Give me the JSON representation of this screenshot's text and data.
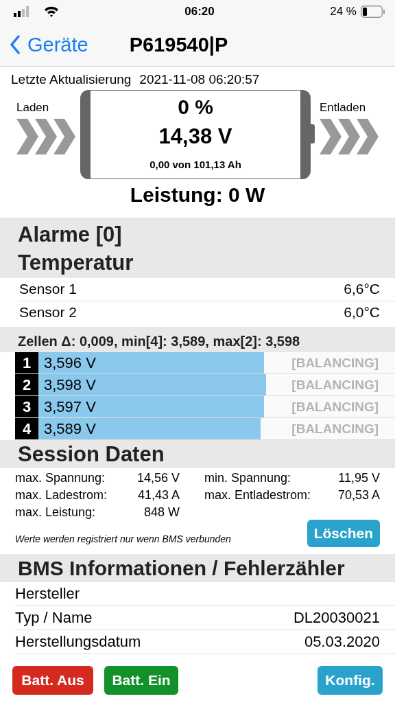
{
  "status_bar": {
    "time": "06:20",
    "battery_text": "24 %"
  },
  "nav": {
    "back_label": "Geräte",
    "title": "P619540|P"
  },
  "update": {
    "label": "Letzte Aktualisierung",
    "value": "2021-11-08 06:20:57"
  },
  "battery": {
    "charge_label": "Laden",
    "discharge_label": "Entladen",
    "percent": "0 %",
    "voltage": "14,38 V",
    "capacity": "0,00 von 101,13 Ah",
    "power": "Leistung: 0 W"
  },
  "alarms": {
    "title": "Alarme [0]"
  },
  "temperature": {
    "title": "Temperatur",
    "sensors": [
      {
        "name": "Sensor 1",
        "value": "6,6°C"
      },
      {
        "name": "Sensor 2",
        "value": "6,0°C"
      }
    ]
  },
  "cells": {
    "summary": "Zellen Δ: 0,009, min[4]: 3,589, max[2]: 3,598",
    "items": [
      {
        "index": "1",
        "voltage": "3,596 V",
        "level": 0.632,
        "balancing_label": "[BALANCING]",
        "balancing": false
      },
      {
        "index": "2",
        "voltage": "3,598 V",
        "level": 0.638,
        "balancing_label": "[BALANCING]",
        "balancing": false
      },
      {
        "index": "3",
        "voltage": "3,597 V",
        "level": 0.632,
        "balancing_label": "[BALANCING]",
        "balancing": false
      },
      {
        "index": "4",
        "voltage": "3,589 V",
        "level": 0.624,
        "balancing_label": "[BALANCING]",
        "balancing": false
      }
    ]
  },
  "session": {
    "title": "Session Daten",
    "stats": [
      {
        "label": "max. Spannung:",
        "value": "14,56 V"
      },
      {
        "label": "min. Spannung:",
        "value": "11,95 V"
      },
      {
        "label": "max. Ladestrom:",
        "value": "41,43 A"
      },
      {
        "label": "max. Entladestrom:",
        "value": "70,53 A"
      },
      {
        "label": "max. Leistung:",
        "value": "848 W"
      }
    ],
    "note": "Werte werden registriert nur wenn BMS verbunden",
    "clear_button": "Löschen"
  },
  "bms": {
    "title": "BMS Informationen / Fehlerzähler",
    "rows": [
      {
        "label": "Hersteller"
      },
      {
        "label": "Typ / Name",
        "value": "DL20030021"
      },
      {
        "label": "Herstellungsdatum",
        "value": "05.03.2020"
      }
    ]
  },
  "footer": {
    "buttons": [
      {
        "label": "Batt. Aus",
        "kind": "danger"
      },
      {
        "label": "Batt. Ein",
        "kind": "success"
      },
      {
        "label": "Konfig.",
        "kind": "info"
      }
    ]
  }
}
